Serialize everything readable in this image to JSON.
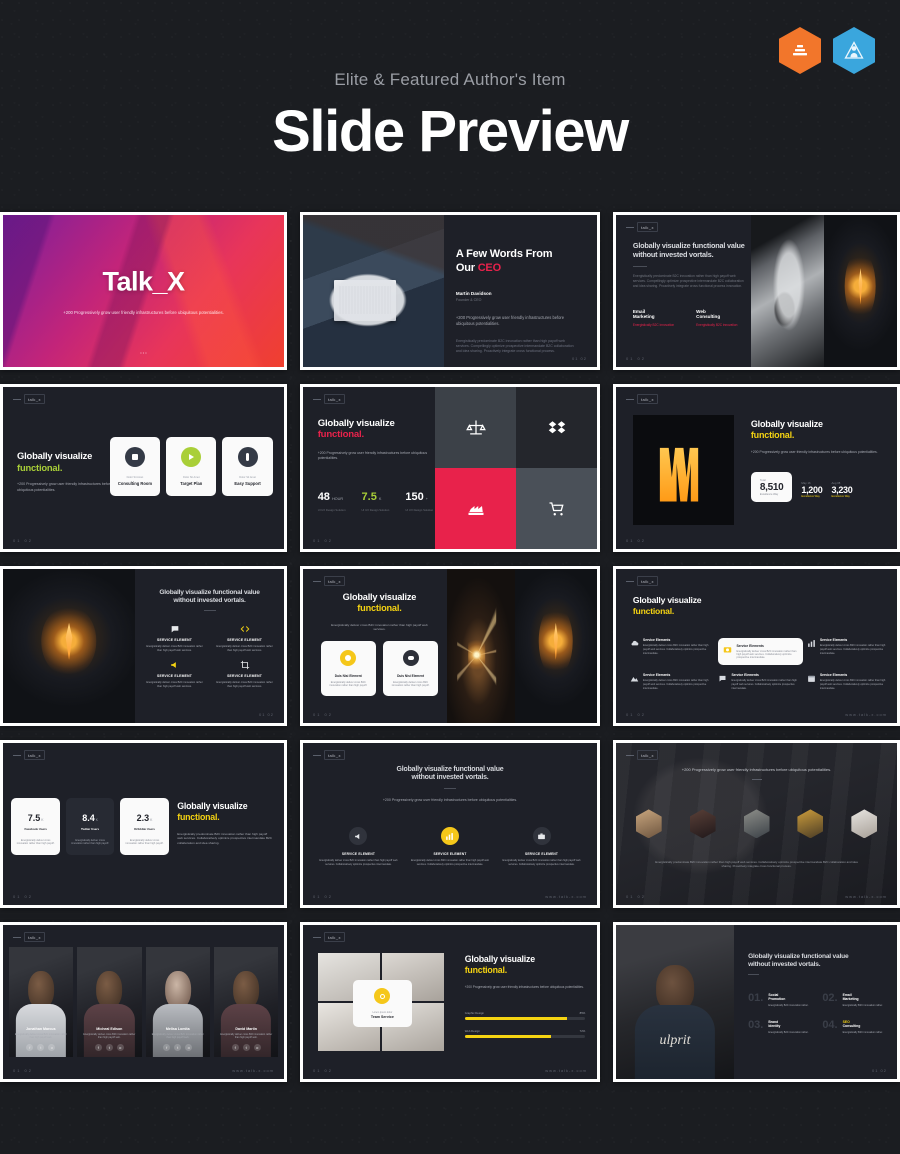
{
  "header": {
    "subtitle": "Elite & Featured Author's Item",
    "title": "Slide Preview",
    "badges": [
      {
        "name": "elite-author-badge",
        "color": "#f2762b"
      },
      {
        "name": "featured-author-badge",
        "color": "#3aa6dd"
      }
    ]
  },
  "common": {
    "brand": "talk_x",
    "headline_main": "Globally visualize",
    "headline_accent": "functional.",
    "headline_long_1": "Globally visualize functional value",
    "headline_long_2": "without  invested vortals.",
    "lead": "+200 Progressively grow user friendly infrastructures before ubiquitous potentialities.",
    "body_short": "Energistically deliver cross B2C innovation rather than high payoff web services.",
    "body_long": "Energistically predominate B2C innovation rather than high payoff web services. Compellingly optimize prospective intermandate B2C collaboration and idea sharing. Proactively integrate cross functional process.",
    "pager": "01  02",
    "pager_right": "www.talk-x.com"
  },
  "slides": [
    {
      "id": "slide-title",
      "title": "Talk_X",
      "subtitle": "+200 Progressively grow user friendly infrastructures before ubiquitous potentialities.",
      "dots": "• • •"
    },
    {
      "id": "slide-ceo",
      "title_line1": "A Few Words From",
      "title_line2_plain": "Our ",
      "title_line2_accent": "CEO",
      "person": "Martin Davidson",
      "role": "Founder & CEO",
      "lead": "+200 Progressively grow user friendly infrastructures before ubiquitous potentialities.",
      "body": "Energistically predominate B2C innovation rather than high payoff web services. Compellingly optimize prospective intermandate B2C collaboration and idea sharing. Proactively integrate cross functional process."
    },
    {
      "id": "slide-services-two",
      "title_line1": "Globally visualize functional value",
      "title_line2": "without  invested vortals.",
      "body": "Energistically predominate B2C innovation rather than high payoff web services. Compellingly optimize prospective intermandate B2C collaboration and idea sharing. Proactively integrate cross functional process innovation.",
      "items": [
        {
          "title_1": "Email",
          "title_2": "Marketing",
          "note": "Energistically B2C innovation"
        },
        {
          "title_1": "Web",
          "title_2": "Consulting",
          "note": "Energistically B2C innovation"
        }
      ]
    },
    {
      "id": "slide-three-cards",
      "headline_main": "Globally visualize",
      "headline_accent": "functional.",
      "accent": "#a9cf38",
      "lead": "+200 Progressively grow user friendly infrastructures before ubiquitous potentialities.",
      "cards": [
        {
          "eyebrow": "Dolor Sit Amet",
          "label": "Consulting Room",
          "icon": "monitor-icon",
          "color": "#343a46"
        },
        {
          "eyebrow": "Dolor Sit Amet",
          "label": "Target Plan",
          "icon": "target-icon",
          "color": "#a9cf38"
        },
        {
          "eyebrow": "Dolor Sit Amet",
          "label": "Easy Support",
          "icon": "support-icon",
          "color": "#343a46"
        }
      ]
    },
    {
      "id": "slide-stats-mosaic",
      "headline_main": "Globally visualize",
      "headline_accent": "functional.",
      "accent": "#e8224b",
      "lead": "+200 Progressively grow user friendly infrastructures before ubiquitous potentialities.",
      "stats": [
        {
          "value": "48",
          "unit": "HOUR",
          "caption": "UI UX Design Solution"
        },
        {
          "value": "7.5",
          "unit": "K",
          "caption": "UI UX Design Solution"
        },
        {
          "value": "150",
          "unit": "+",
          "caption": "UI UX Design Solution"
        }
      ],
      "tiles": [
        {
          "icon": "balance-scale-icon",
          "bg": "#3c4148"
        },
        {
          "icon": "dropbox-icon",
          "bg": "#24262c"
        },
        {
          "icon": "factory-icon",
          "bg": "#e8224b"
        },
        {
          "icon": "cart-icon",
          "bg": "#444a52"
        }
      ]
    },
    {
      "id": "slide-neon-stats",
      "headline_main": "Globally visualize",
      "headline_accent": "functional.",
      "accent": "#f5d312",
      "lead": "+200 Progressively grow user friendly infrastructures before ubiquitous potentialities.",
      "stats": [
        {
          "eyebrow": "Total",
          "value": "8,510",
          "caption": "Excellence Way",
          "highlight": true
        },
        {
          "eyebrow": "May 16",
          "value": "1,200",
          "caption": "Excellence Way",
          "highlight": false
        },
        {
          "eyebrow": "Aug 08",
          "value": "3,230",
          "caption": "Excellence Way",
          "highlight": false
        }
      ]
    },
    {
      "id": "slide-service-2x2",
      "title_line1": "Globally visualize functional value",
      "title_line2": "without  invested vortals.",
      "items": [
        {
          "icon": "chat-icon",
          "title": "SERVICE ELEMENT",
          "body": "Energistically deliver cross B2C innovation rather than high payoff web services.",
          "color": "#e7e9ec"
        },
        {
          "icon": "code-icon",
          "title": "SERVICE ELEMENT",
          "body": "Energistically deliver cross B2C innovation rather than high payoff web services.",
          "color": "#f5d312"
        },
        {
          "icon": "megaphone-icon",
          "title": "SERVICE ELEMENT",
          "body": "Energistically deliver cross B2C innovation rather than high payoff web services.",
          "color": "#f5d312"
        },
        {
          "icon": "crop-icon",
          "title": "SERVICE ELEMENT",
          "body": "Energistically deliver cross B2C innovation rather than high payoff web services.",
          "color": "#e7e9ec"
        }
      ]
    },
    {
      "id": "slide-two-cards",
      "headline_main": "Globally visualize",
      "headline_accent": "functional.",
      "accent": "#f5d312",
      "body": "Energistically deliver cross B2C innovation rather than high payoff web services.",
      "cards": [
        {
          "icon": "idea-icon",
          "label": "Duis Nisi Element",
          "body": "Energistically deliver cross B2C innovation rather than high payoff.",
          "color": "#f5c71a"
        },
        {
          "icon": "cloud-icon",
          "label": "Duis Nisi Element",
          "body": "Energistically deliver cross B2C innovation rather than high payoff.",
          "color": "#2d3039"
        }
      ]
    },
    {
      "id": "slide-service-grid-6",
      "headline_main": "Globally visualize",
      "headline_accent": "functional.",
      "accent": "#f5d312",
      "items": [
        {
          "icon": "cloud-upload-icon",
          "title": "Service Elements",
          "body": "Energistically deliver cross B2C innovation rather than high payoff web services. Collaboratively optimize prospective intermandate.",
          "highlight": false
        },
        {
          "icon": "camera-icon",
          "title": "Service Elements",
          "body": "Energistically deliver cross B2C innovation rather than high payoff web services. Collaboratively optimize prospective intermandate.",
          "highlight": true
        },
        {
          "icon": "chart-bar-icon",
          "title": "Service Elements",
          "body": "Energistically deliver cross B2C innovation rather than high payoff web services. Collaboratively optimize prospective intermandate.",
          "highlight": false
        },
        {
          "icon": "mountain-icon",
          "title": "Service Elements",
          "body": "Energistically deliver cross B2C innovation rather than high payoff web services. Collaboratively optimize prospective intermandate.",
          "highlight": false
        },
        {
          "icon": "chat-bubble-icon",
          "title": "Service Elements",
          "body": "Energistically deliver cross B2C innovation rather than high payoff web services. Collaboratively optimize prospective intermandate.",
          "highlight": false
        },
        {
          "icon": "calendar-icon",
          "title": "Service Elements",
          "body": "Energistically deliver cross B2C innovation rather than high payoff web services. Collaboratively optimize prospective intermandate.",
          "highlight": false
        }
      ]
    },
    {
      "id": "slide-stat-cards",
      "headline_main": "Globally visualize",
      "headline_accent": "functional.",
      "accent": "#f5d312",
      "body": "Energistically predominate B2C innovation rather than high payoff web services. Collaboratively optimize prospective intermandate B2C collaboration and idea sharing.",
      "cards": [
        {
          "value": "7.5",
          "unit": "K",
          "label": "Facebook Users",
          "body": "Energistically deliver cross innovation rather than high payoff.",
          "dark": false
        },
        {
          "value": "8.4",
          "unit": "K",
          "label": "Twitter Users",
          "body": "Energistically deliver cross innovation rather than high payoff.",
          "dark": true
        },
        {
          "value": "2.3",
          "unit": "K",
          "label": "Dribbble Users",
          "body": "Energistically deliver cross innovation rather than high payoff.",
          "dark": false
        }
      ]
    },
    {
      "id": "slide-three-icons",
      "title_line1": "Globally visualize functional value",
      "title_line2": "without  invested vortals.",
      "lead": "+200 Progressively grow user friendly infrastructures before ubiquitous potentialities.",
      "items": [
        {
          "icon": "megaphone-icon",
          "title": "SERVICE ELEMENT",
          "body": "Energistically deliver cross B2C innovation rather than high payoff web services. Collaboratively optimize prospective intermandate.",
          "highlight": false
        },
        {
          "icon": "chart-bar-icon",
          "title": "SERVICE ELEMENT",
          "body": "Energistically deliver cross B2C innovation rather than high payoff web services. Collaboratively optimize prospective intermandate.",
          "highlight": true
        },
        {
          "icon": "briefcase-icon",
          "title": "SERVICE ELEMENT",
          "body": "Energistically deliver cross B2C innovation rather than high payoff web services. Collaboratively optimize prospective intermandate.",
          "highlight": false
        }
      ]
    },
    {
      "id": "slide-testimonial-avatars",
      "lead": "+200 Progressively grow user friendly infrastructures before ubiquitous potentialities.",
      "body": "Energistically predominate B2C innovation rather than high payoff web services. Collaboratively optimize prospective intermandate B2C collaboration and idea sharing. Proactively integrate cross functional process.",
      "avatars": 5
    },
    {
      "id": "slide-team-4",
      "members": [
        {
          "name": "Jonathan Marcus",
          "role": "Energistically deliver cross B2C innovation rather than high payoff web."
        },
        {
          "name": "Micheal Edison",
          "role": "Energistically deliver cross B2C innovation rather than high payoff web."
        },
        {
          "name": "Melisa Lomita",
          "role": "Energistically deliver cross B2C innovation rather than high payoff web."
        },
        {
          "name": "David Martin",
          "role": "Energistically deliver cross B2C innovation rather than high payoff web."
        }
      ],
      "social": [
        "f",
        "t",
        "o"
      ]
    },
    {
      "id": "slide-team-service",
      "headline_main": "Globally visualize",
      "headline_accent": "functional.",
      "accent": "#f5d312",
      "lead": "+200 Progressively grow user friendly infrastructures before ubiquitous potentialities.",
      "overlay_eyebrow": "Lorem ipsum dolor",
      "overlay_title": "Team Service",
      "bars": [
        {
          "label": "Graphic Design",
          "value": "85%",
          "pct": 85
        },
        {
          "label": "Web Design",
          "value": "72%",
          "pct": 72
        }
      ]
    },
    {
      "id": "slide-numbered-list",
      "title_line1": "Globally visualize functional value",
      "title_line2": "without  invested vortals.",
      "items": [
        {
          "num": "01.",
          "title_1": "Social",
          "title_2": "Promotion",
          "body": "Energistically B2C innovation rather."
        },
        {
          "num": "02.",
          "title_1": "Email",
          "title_2": "Marketing",
          "body": "Energistically B2C innovation rather."
        },
        {
          "num": "03.",
          "title_1": "Brand",
          "title_2": "Identity",
          "body": "Energistically B2C innovation rather."
        },
        {
          "num": "04.",
          "title_1": "SEO",
          "title_2": "Consulting",
          "body": "Energistically B2C innovation rather."
        }
      ]
    }
  ]
}
